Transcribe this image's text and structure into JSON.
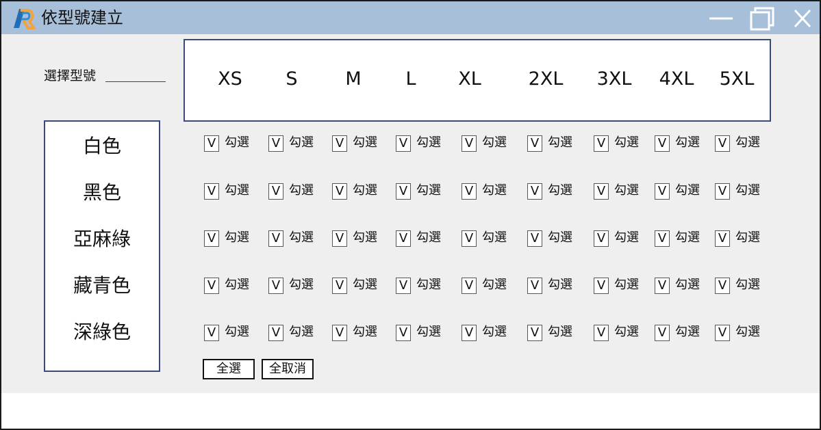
{
  "window": {
    "title": "依型號建立",
    "controls": [
      "minimize-icon",
      "maximize-icon",
      "close-icon"
    ]
  },
  "form": {
    "select_model_label": "選擇型號",
    "sizes": [
      "XS",
      "S",
      "M",
      "L",
      "XL",
      "2XL",
      "3XL",
      "4XL",
      "5XL"
    ],
    "colors": [
      "白色",
      "黑色",
      "亞麻綠",
      "藏青色",
      "深綠色"
    ],
    "checkbox_mark": "V",
    "checkbox_label": "勾選",
    "select_all": "全選",
    "deselect_all": "全取消"
  },
  "theme": {
    "titlebar": "#a7bfd9",
    "border_accent": "#394a78"
  }
}
